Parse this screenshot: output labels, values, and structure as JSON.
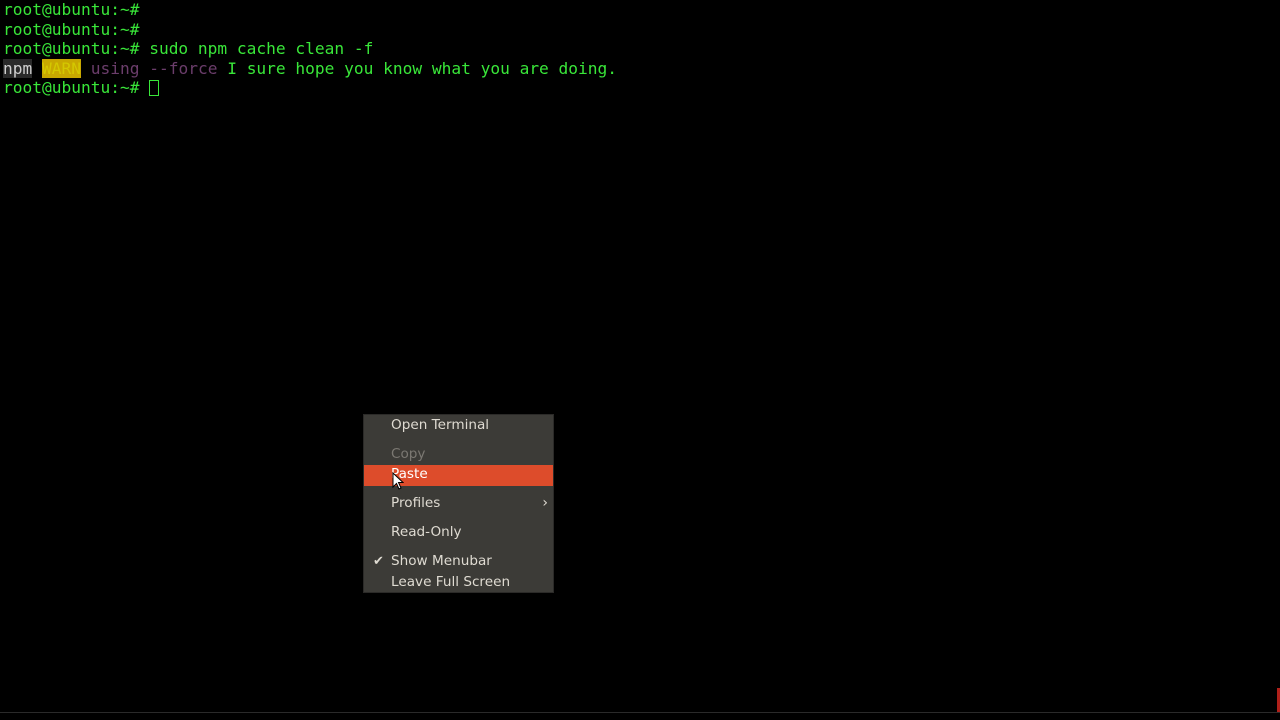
{
  "terminal": {
    "lines": [
      {
        "prompt": "root@ubuntu:~#",
        "command": ""
      },
      {
        "prompt": "root@ubuntu:~#",
        "command": ""
      },
      {
        "prompt": "root@ubuntu:~#",
        "command": " sudo npm cache clean -f"
      }
    ],
    "warn_line": {
      "npm": "npm",
      "warn": "WARN",
      "using": " using ",
      "force": "--force",
      "message": " I sure hope you know what you are doing."
    },
    "current_prompt": "root@ubuntu:~#"
  },
  "context_menu": {
    "items": [
      {
        "label": "Open Terminal"
      },
      {
        "label": "Copy"
      },
      {
        "label": "Paste"
      },
      {
        "label": "Profiles"
      },
      {
        "label": "Read-Only"
      },
      {
        "label": "Show Menubar"
      },
      {
        "label": "Leave Full Screen"
      }
    ]
  },
  "colors": {
    "terminal_fg": "#39e639",
    "menu_bg": "#3c3b37",
    "menu_highlight": "#dd4c2b"
  },
  "icons": {
    "check": "check-icon",
    "submenu": "chevron-right-icon",
    "pointer": "mouse-pointer-icon"
  }
}
